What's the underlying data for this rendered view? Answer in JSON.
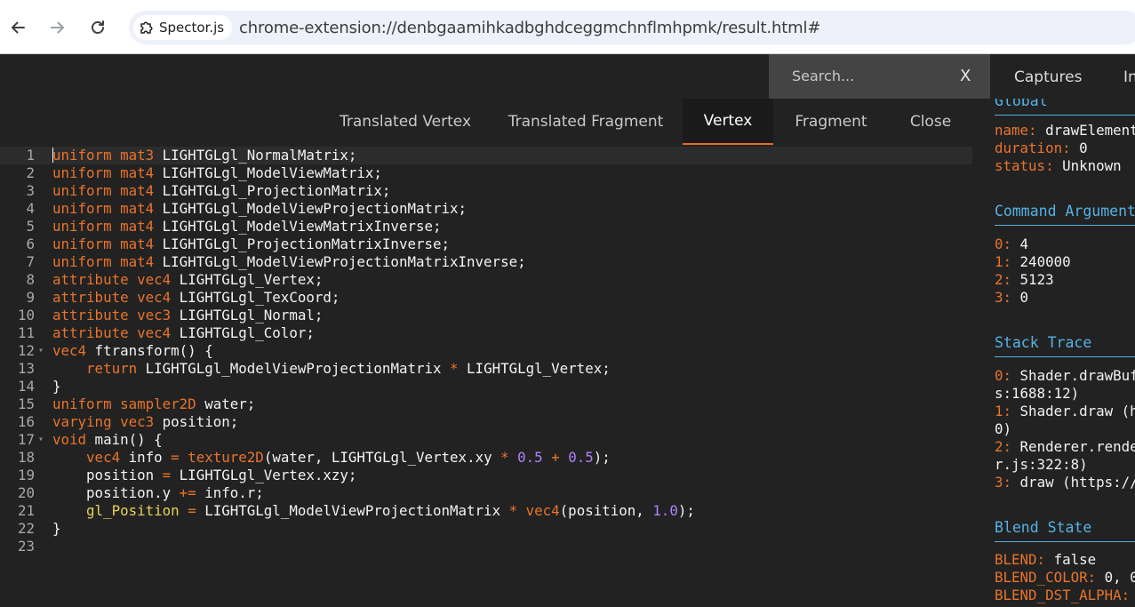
{
  "browser": {
    "chip_label": "Spector.js",
    "url": "chrome-extension://denbgaamihkadbghdceggmchnflmhpmk/result.html#"
  },
  "app": {
    "search_placeholder": "Search...",
    "search_close": "X",
    "top_tabs": [
      "Captures",
      "In"
    ],
    "tabs": [
      {
        "label": "Translated Vertex",
        "active": false
      },
      {
        "label": "Translated Fragment",
        "active": false
      },
      {
        "label": "Vertex",
        "active": true
      },
      {
        "label": "Fragment",
        "active": false
      },
      {
        "label": "Close",
        "active": false
      }
    ]
  },
  "code_lines": [
    [
      [
        "kw",
        "uniform"
      ],
      [
        "t",
        " "
      ],
      [
        "kw",
        "mat3"
      ],
      [
        "t",
        " LIGHTGLgl_NormalMatrix;"
      ]
    ],
    [
      [
        "kw",
        "uniform"
      ],
      [
        "t",
        " "
      ],
      [
        "kw",
        "mat4"
      ],
      [
        "t",
        " LIGHTGLgl_ModelViewMatrix;"
      ]
    ],
    [
      [
        "kw",
        "uniform"
      ],
      [
        "t",
        " "
      ],
      [
        "kw",
        "mat4"
      ],
      [
        "t",
        " LIGHTGLgl_ProjectionMatrix;"
      ]
    ],
    [
      [
        "kw",
        "uniform"
      ],
      [
        "t",
        " "
      ],
      [
        "kw",
        "mat4"
      ],
      [
        "t",
        " LIGHTGLgl_ModelViewProjectionMatrix;"
      ]
    ],
    [
      [
        "kw",
        "uniform"
      ],
      [
        "t",
        " "
      ],
      [
        "kw",
        "mat4"
      ],
      [
        "t",
        " LIGHTGLgl_ModelViewMatrixInverse;"
      ]
    ],
    [
      [
        "kw",
        "uniform"
      ],
      [
        "t",
        " "
      ],
      [
        "kw",
        "mat4"
      ],
      [
        "t",
        " LIGHTGLgl_ProjectionMatrixInverse;"
      ]
    ],
    [
      [
        "kw",
        "uniform"
      ],
      [
        "t",
        " "
      ],
      [
        "kw",
        "mat4"
      ],
      [
        "t",
        " LIGHTGLgl_ModelViewProjectionMatrixInverse;"
      ]
    ],
    [
      [
        "kw",
        "attribute"
      ],
      [
        "t",
        " "
      ],
      [
        "kw",
        "vec4"
      ],
      [
        "t",
        " LIGHTGLgl_Vertex;"
      ]
    ],
    [
      [
        "kw",
        "attribute"
      ],
      [
        "t",
        " "
      ],
      [
        "kw",
        "vec4"
      ],
      [
        "t",
        " LIGHTGLgl_TexCoord;"
      ]
    ],
    [
      [
        "kw",
        "attribute"
      ],
      [
        "t",
        " "
      ],
      [
        "kw",
        "vec3"
      ],
      [
        "t",
        " LIGHTGLgl_Normal;"
      ]
    ],
    [
      [
        "kw",
        "attribute"
      ],
      [
        "t",
        " "
      ],
      [
        "kw",
        "vec4"
      ],
      [
        "t",
        " LIGHTGLgl_Color;"
      ]
    ],
    [
      [
        "kw",
        "vec4"
      ],
      [
        "t",
        " ftransform() {"
      ]
    ],
    [
      [
        "t",
        "    "
      ],
      [
        "kw",
        "return"
      ],
      [
        "t",
        " LIGHTGLgl_ModelViewProjectionMatrix "
      ],
      [
        "op",
        "*"
      ],
      [
        "t",
        " LIGHTGLgl_Vertex;"
      ]
    ],
    [
      [
        "t",
        "}"
      ]
    ],
    [
      [
        "kw",
        "uniform"
      ],
      [
        "t",
        " "
      ],
      [
        "kw",
        "sampler2D"
      ],
      [
        "t",
        " water;"
      ]
    ],
    [
      [
        "kw",
        "varying"
      ],
      [
        "t",
        " "
      ],
      [
        "kw",
        "vec3"
      ],
      [
        "t",
        " position;"
      ]
    ],
    [
      [
        "kw",
        "void"
      ],
      [
        "t",
        " main() {"
      ]
    ],
    [
      [
        "t",
        "    "
      ],
      [
        "kw",
        "vec4"
      ],
      [
        "t",
        " info "
      ],
      [
        "op",
        "="
      ],
      [
        "t",
        " "
      ],
      [
        "fn",
        "texture2D"
      ],
      [
        "t",
        "(water, LIGHTGLgl_Vertex.xy "
      ],
      [
        "op",
        "*"
      ],
      [
        "t",
        " "
      ],
      [
        "num",
        "0.5"
      ],
      [
        "t",
        " "
      ],
      [
        "op",
        "+"
      ],
      [
        "t",
        " "
      ],
      [
        "num",
        "0.5"
      ],
      [
        "t",
        ");"
      ]
    ],
    [
      [
        "t",
        "    position "
      ],
      [
        "op",
        "="
      ],
      [
        "t",
        " LIGHTGLgl_Vertex.xzy;"
      ]
    ],
    [
      [
        "t",
        "    position.y "
      ],
      [
        "op",
        "+="
      ],
      [
        "t",
        " info.r;"
      ]
    ],
    [
      [
        "t",
        "    "
      ],
      [
        "gp",
        "gl_Position"
      ],
      [
        "t",
        " "
      ],
      [
        "op",
        "="
      ],
      [
        "t",
        " LIGHTGLgl_ModelViewProjectionMatrix "
      ],
      [
        "op",
        "*"
      ],
      [
        "t",
        " "
      ],
      [
        "fn",
        "vec4"
      ],
      [
        "t",
        "(position, "
      ],
      [
        "num",
        "1.0"
      ],
      [
        "t",
        ");"
      ]
    ],
    [
      [
        "t",
        "}"
      ]
    ],
    [
      [
        "t",
        ""
      ]
    ]
  ],
  "foldable_lines": [
    12,
    17
  ],
  "right_panel": {
    "global": {
      "title": "Global",
      "rows": [
        {
          "key": "name:",
          "value": " drawElements"
        },
        {
          "key": "duration:",
          "value": " 0"
        },
        {
          "key": "status:",
          "value": " Unknown"
        }
      ]
    },
    "command_arguments": {
      "title": "Command Arguments",
      "rows": [
        {
          "key": "0:",
          "value": " 4"
        },
        {
          "key": "1:",
          "value": " 240000"
        },
        {
          "key": "2:",
          "value": " 5123"
        },
        {
          "key": "3:",
          "value": " 0"
        }
      ]
    },
    "stack_trace": {
      "title": "Stack Trace",
      "rows": [
        {
          "key": "0:",
          "value": " Shader.drawBuffers"
        },
        {
          "key": "",
          "value": "s:1688:12)"
        },
        {
          "key": "1:",
          "value": " Shader.draw (h"
        },
        {
          "key": "",
          "value": "0)"
        },
        {
          "key": "2:",
          "value": " Renderer.render"
        },
        {
          "key": "",
          "value": "r.js:322:8)"
        },
        {
          "key": "3:",
          "value": " draw (https://"
        }
      ]
    },
    "blend_state": {
      "title": "Blend State",
      "rows": [
        {
          "key": "BLEND:",
          "value": " false"
        },
        {
          "key": "BLEND_COLOR:",
          "value": " 0, 0"
        },
        {
          "key": "BLEND_DST_ALPHA:",
          "value": " "
        }
      ]
    }
  }
}
